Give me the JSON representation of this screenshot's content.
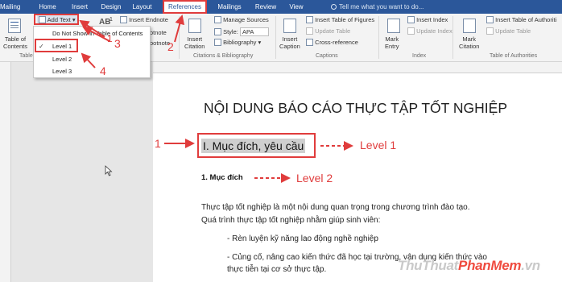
{
  "tabs": [
    "Mailings",
    "Home",
    "Insert",
    "Design",
    "Layout",
    "References",
    "Mailings",
    "Review",
    "View"
  ],
  "tell_me": "Tell me what you want to do...",
  "ribbon": {
    "toc_label": "Table of\nContents",
    "toc_group": "Table",
    "add_text": "Add Text",
    "ab": "AB",
    "superscript": "1",
    "insert_endnote": "Insert Endnote",
    "footnote_fragment": "otnote",
    "footnotes_fragment": "ootnote",
    "insert_citation": "Insert\nCitation",
    "manage_sources": "Manage Sources",
    "style_label": "Style:",
    "style_value": "APA",
    "bibliography": "Bibliography",
    "citations_group": "Citations & Bibliography",
    "insert_caption": "Insert\nCaption",
    "insert_table_of_figures": "Insert Table of Figures",
    "update_table": "Update Table",
    "cross_reference": "Cross-reference",
    "captions_group": "Captions",
    "mark_entry": "Mark\nEntry",
    "insert_index": "Insert Index",
    "update_index": "Update Index",
    "index_group": "Index",
    "mark_citation": "Mark\nCitation",
    "insert_table_of_authorities": "Insert Table of Authoriti",
    "update_table2": "Update Table",
    "authorities_group": "Table of Authorities"
  },
  "dropdown": {
    "items": [
      "Do Not Show in Table of Contents",
      "Level 1",
      "Level 2",
      "Level 3"
    ]
  },
  "annotations": [
    "1",
    "2",
    "3",
    "4",
    "1",
    "Level 1",
    "Level 2"
  ],
  "document": {
    "title": "NỘI DUNG BÁO CÁO THỰC TẬP TỐT NGHIỆP",
    "heading1": "I. Mục đích, yêu cầu",
    "heading2": "1. Mục đích",
    "para1": "Thực tập tốt nghiệp là một nội dung quan trọng trong chương trình đào tạo.",
    "para2": "Quá trình thực tập tốt nghiệp nhằm giúp sinh viên:",
    "bullet1": "- Rèn luyện kỹ năng lao động nghề nghiệp",
    "bullet2": "- Củng cố, nâng cao kiến thức đã học tại trường, vận dụng kiến thức vào",
    "para3": "thực tiễn tại cơ sở thực tập."
  },
  "watermark": {
    "part1": "ThuThuat",
    "part2": "PhanMem",
    "part3": ".vn"
  },
  "colors": {
    "brand": "#2b579a",
    "annotation": "#e03c3c"
  }
}
